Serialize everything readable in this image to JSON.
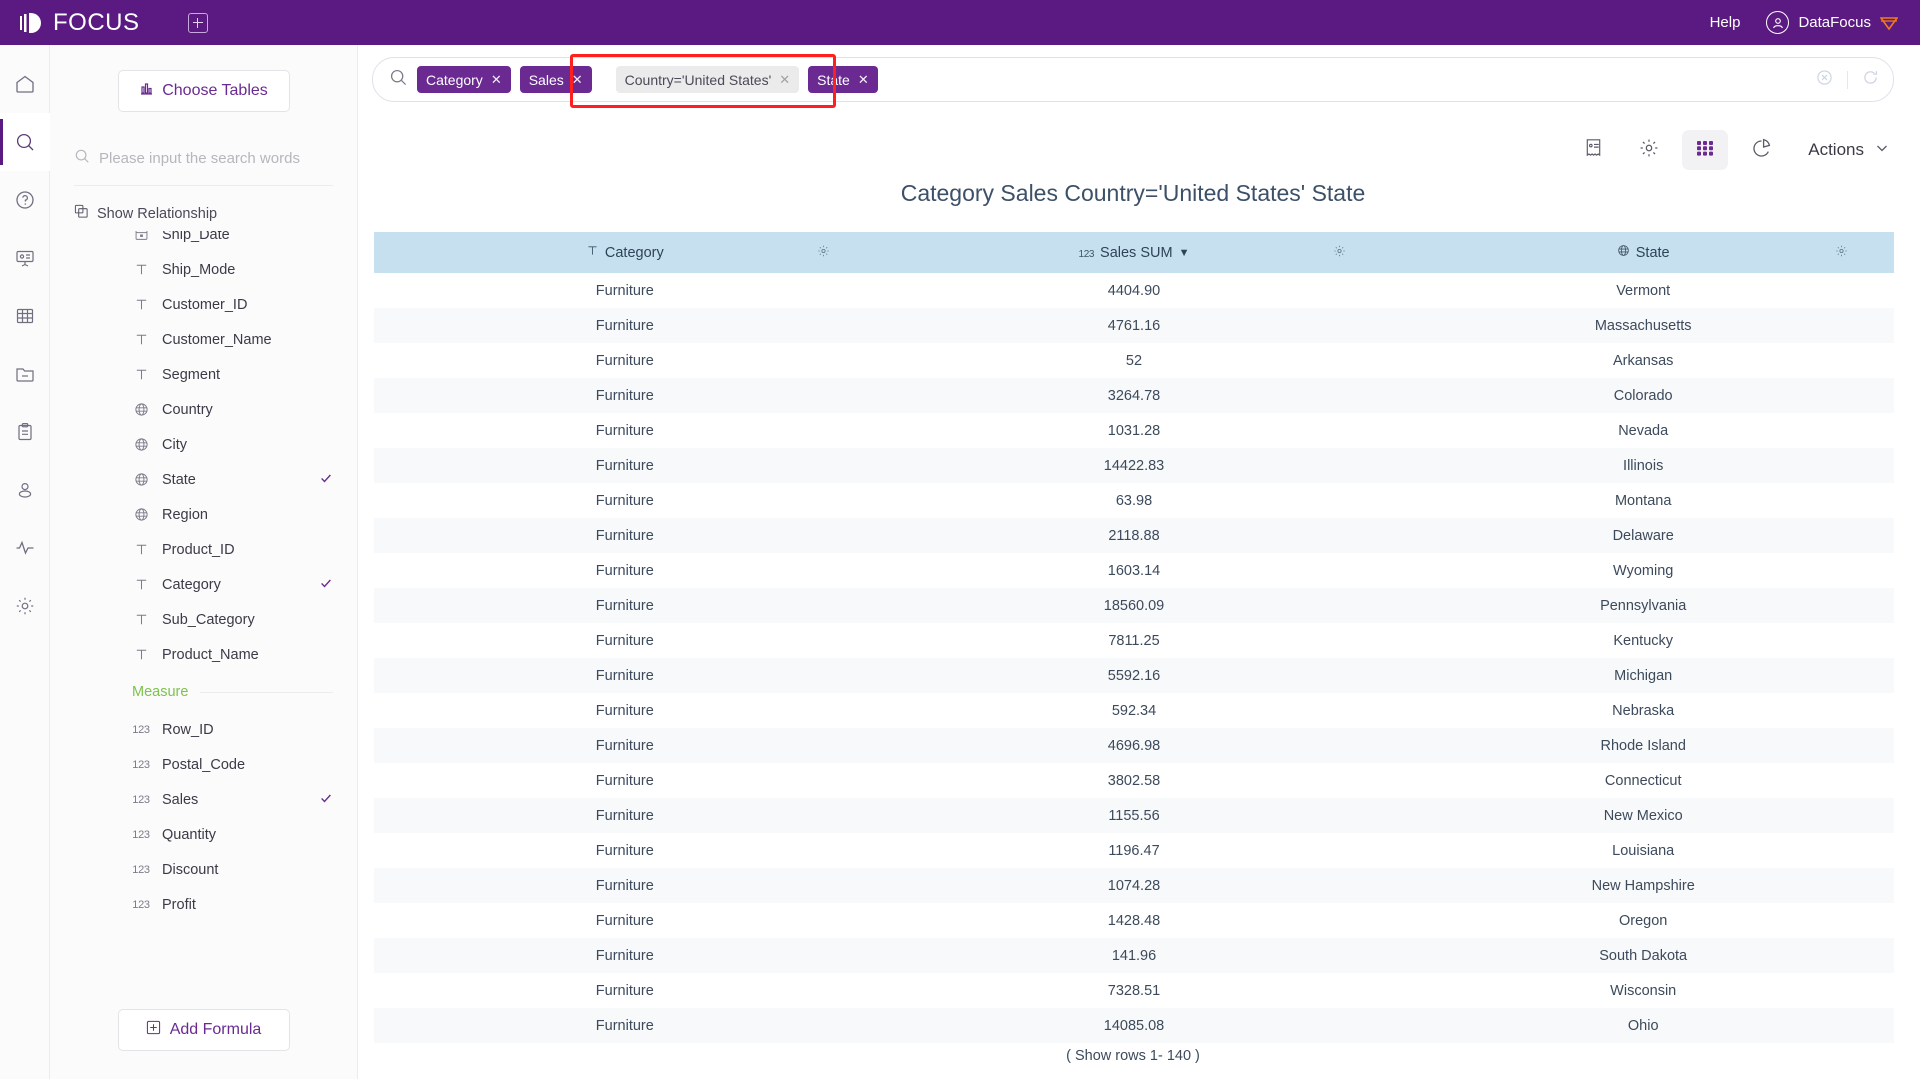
{
  "header": {
    "brand": "FOCUS",
    "new_tab_icon": "plus-square-icon",
    "help_label": "Help",
    "user_label": "DataFocus",
    "accent_purple": "#5b1a82"
  },
  "rail": {
    "items": [
      {
        "name": "home",
        "icon": "home-icon",
        "active": false
      },
      {
        "name": "search",
        "icon": "search-icon",
        "active": true
      },
      {
        "name": "help",
        "icon": "question-circle-icon",
        "active": false
      },
      {
        "name": "presentation",
        "icon": "presentation-icon",
        "active": false
      },
      {
        "name": "tables",
        "icon": "table-grid-icon",
        "active": false
      },
      {
        "name": "folder",
        "icon": "folder-minus-icon",
        "active": false
      },
      {
        "name": "clipboard",
        "icon": "clipboard-icon",
        "active": false
      },
      {
        "name": "user",
        "icon": "user-icon",
        "active": false
      },
      {
        "name": "activity",
        "icon": "pulse-icon",
        "active": false
      },
      {
        "name": "settings",
        "icon": "gear-icon",
        "active": false
      }
    ]
  },
  "sidebar": {
    "choose_tables_label": "Choose Tables",
    "choose_tables_icon": "bar-chart-icon",
    "search_placeholder": "Please input the search words",
    "search_value": "",
    "search_icon": "search-icon",
    "show_relationship_label": "Show Relationship",
    "show_relationship_icon": "relationship-icon",
    "attributes": [
      {
        "label": "Ship_Date",
        "type": "date",
        "selected": false
      },
      {
        "label": "Ship_Mode",
        "type": "text",
        "selected": false
      },
      {
        "label": "Customer_ID",
        "type": "text",
        "selected": false
      },
      {
        "label": "Customer_Name",
        "type": "text",
        "selected": false
      },
      {
        "label": "Segment",
        "type": "text",
        "selected": false
      },
      {
        "label": "Country",
        "type": "geo",
        "selected": false
      },
      {
        "label": "City",
        "type": "geo",
        "selected": false
      },
      {
        "label": "State",
        "type": "geo",
        "selected": true
      },
      {
        "label": "Region",
        "type": "geo",
        "selected": false
      },
      {
        "label": "Product_ID",
        "type": "text",
        "selected": false
      },
      {
        "label": "Category",
        "type": "text",
        "selected": true
      },
      {
        "label": "Sub_Category",
        "type": "text",
        "selected": false
      },
      {
        "label": "Product_Name",
        "type": "text",
        "selected": false
      }
    ],
    "measure_section_label": "Measure",
    "measures": [
      {
        "label": "Row_ID",
        "type": "number",
        "selected": false
      },
      {
        "label": "Postal_Code",
        "type": "number",
        "selected": false
      },
      {
        "label": "Sales",
        "type": "number",
        "selected": true
      },
      {
        "label": "Quantity",
        "type": "number",
        "selected": false
      },
      {
        "label": "Discount",
        "type": "number",
        "selected": false
      },
      {
        "label": "Profit",
        "type": "number",
        "selected": false
      }
    ],
    "add_formula_label": "Add Formula",
    "add_formula_icon": "plus-square-icon"
  },
  "search": {
    "search_icon": "search-icon",
    "input_value": "",
    "chips": [
      {
        "label": "Category",
        "kind": "column",
        "highlighted": false
      },
      {
        "label": "Sales",
        "kind": "column",
        "highlighted": false
      },
      {
        "label": "Country='United States'",
        "kind": "filter",
        "highlighted": true
      },
      {
        "label": "State",
        "kind": "column",
        "highlighted": true
      }
    ],
    "clear_icon": "clear-circle-icon",
    "refresh_icon": "refresh-icon",
    "highlight_color": "#ff1f1f"
  },
  "toolbar": {
    "buttons": [
      {
        "name": "formula-view",
        "icon": "receipt-icon",
        "active": false
      },
      {
        "name": "settings",
        "icon": "gear-icon",
        "active": false
      },
      {
        "name": "table-view",
        "icon": "grid-icon",
        "active": true
      },
      {
        "name": "chart-view",
        "icon": "pie-chart-icon",
        "active": false
      }
    ],
    "actions_label": "Actions",
    "actions_caret_icon": "chevron-down-icon"
  },
  "main": {
    "title": "Category Sales Country='United States' State",
    "footer": "( Show rows 1- 140 )"
  },
  "chart_data": {
    "type": "table",
    "title": "Category Sales Country='United States' State",
    "columns": [
      {
        "label": "Category",
        "icon": "text-type-icon",
        "sorted": false
      },
      {
        "label": "Sales SUM",
        "icon": "number-type-icon",
        "sorted": true,
        "sort_dir": "desc"
      },
      {
        "label": "State",
        "icon": "geo-type-icon",
        "sorted": false
      }
    ],
    "rows": [
      [
        "Furniture",
        "4404.90",
        "Vermont"
      ],
      [
        "Furniture",
        "4761.16",
        "Massachusetts"
      ],
      [
        "Furniture",
        "52",
        "Arkansas"
      ],
      [
        "Furniture",
        "3264.78",
        "Colorado"
      ],
      [
        "Furniture",
        "1031.28",
        "Nevada"
      ],
      [
        "Furniture",
        "14422.83",
        "Illinois"
      ],
      [
        "Furniture",
        "63.98",
        "Montana"
      ],
      [
        "Furniture",
        "2118.88",
        "Delaware"
      ],
      [
        "Furniture",
        "1603.14",
        "Wyoming"
      ],
      [
        "Furniture",
        "18560.09",
        "Pennsylvania"
      ],
      [
        "Furniture",
        "7811.25",
        "Kentucky"
      ],
      [
        "Furniture",
        "5592.16",
        "Michigan"
      ],
      [
        "Furniture",
        "592.34",
        "Nebraska"
      ],
      [
        "Furniture",
        "4696.98",
        "Rhode Island"
      ],
      [
        "Furniture",
        "3802.58",
        "Connecticut"
      ],
      [
        "Furniture",
        "1155.56",
        "New Mexico"
      ],
      [
        "Furniture",
        "1196.47",
        "Louisiana"
      ],
      [
        "Furniture",
        "1074.28",
        "New Hampshire"
      ],
      [
        "Furniture",
        "1428.48",
        "Oregon"
      ],
      [
        "Furniture",
        "141.96",
        "South Dakota"
      ],
      [
        "Furniture",
        "7328.51",
        "Wisconsin"
      ],
      [
        "Furniture",
        "14085.08",
        "Ohio"
      ]
    ],
    "total_rows": 140,
    "shown_rows": "1- 140"
  }
}
